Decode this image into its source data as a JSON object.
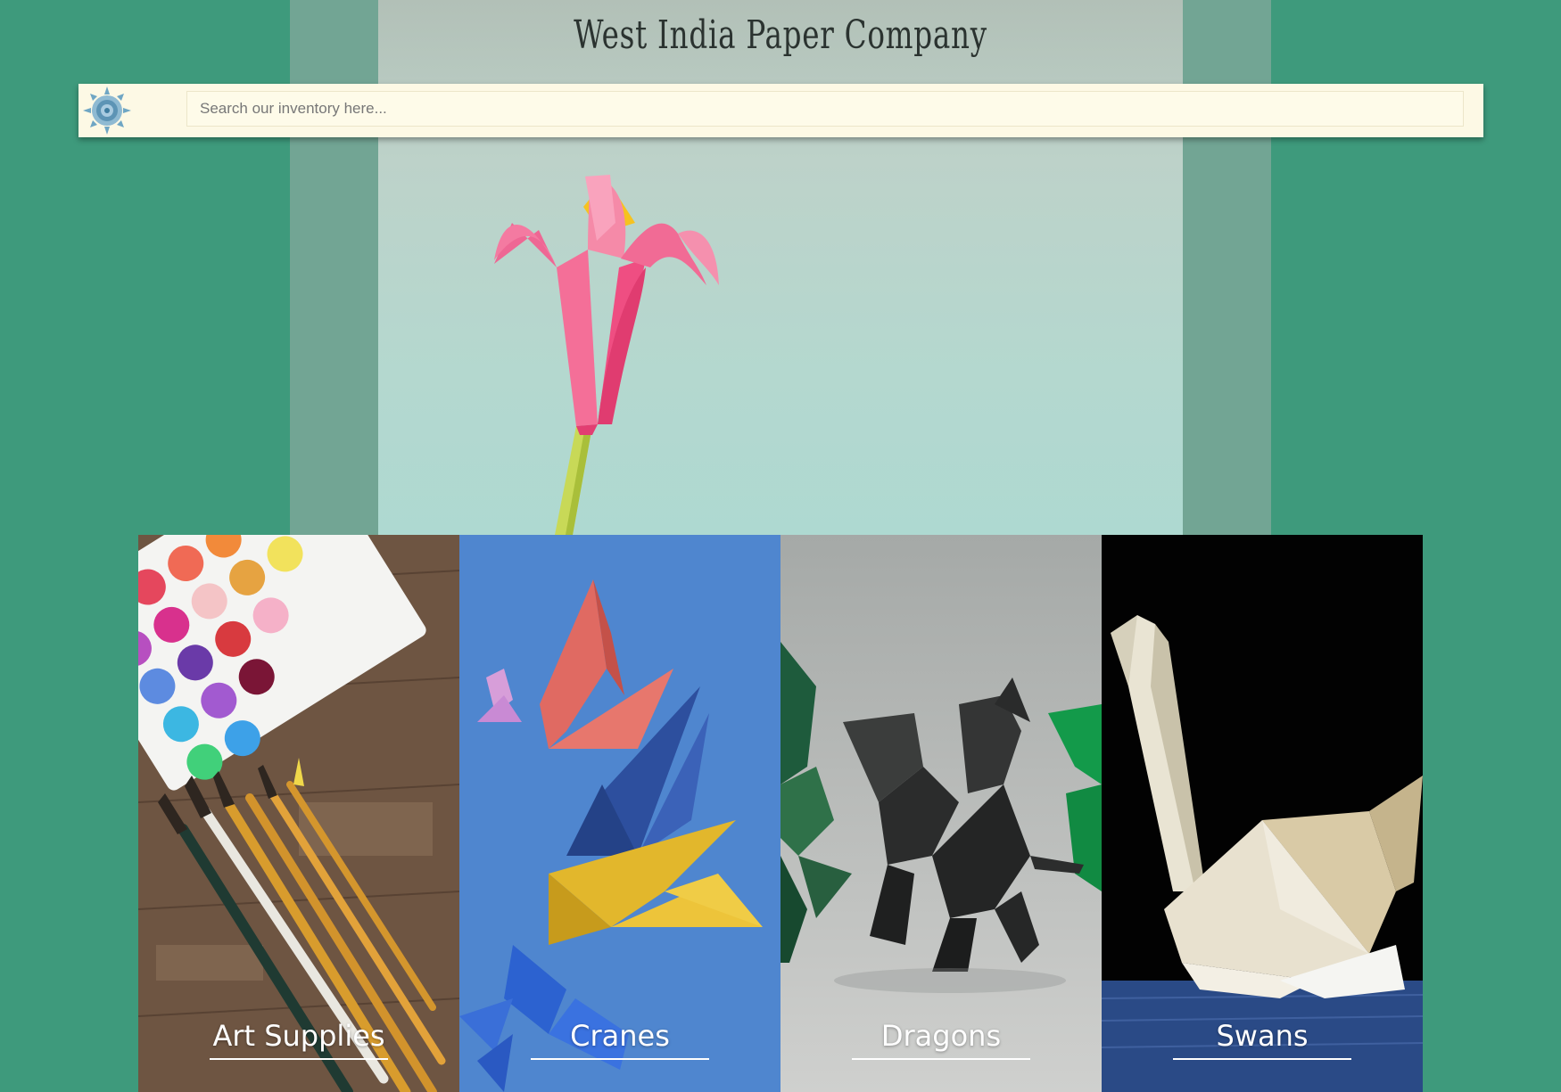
{
  "header": {
    "site_title": "West India Paper Company",
    "logo_icon": "mandala-logo-icon"
  },
  "search": {
    "placeholder": "Search our inventory here..."
  },
  "hero": {
    "image_icon": "origami-lily-icon"
  },
  "categories": [
    {
      "label": "Art Supplies",
      "icon": "paint-palette-icon"
    },
    {
      "label": "Cranes",
      "icon": "origami-crane-icon"
    },
    {
      "label": "Dragons",
      "icon": "origami-dragon-icon"
    },
    {
      "label": "Swans",
      "icon": "origami-swan-icon"
    }
  ],
  "colors": {
    "page_background": "#3e9a7c",
    "hero_band": "#72a594",
    "search_bar": "#fdf9e5",
    "label_text": "#ffffff"
  }
}
